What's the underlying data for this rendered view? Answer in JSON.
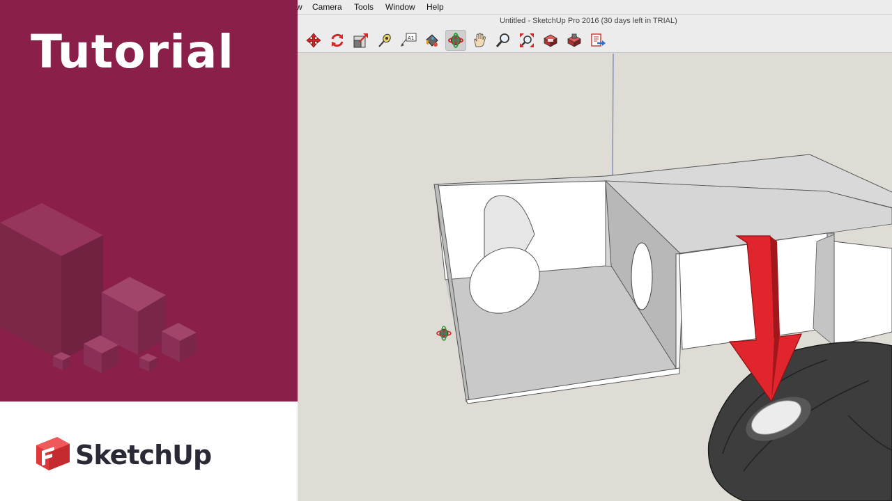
{
  "branding": {
    "heading": "Tutorial",
    "logo_text": "SketchUp",
    "accent_color": "#8a1f4a"
  },
  "menu": {
    "items": [
      {
        "label": "w"
      },
      {
        "label": "Camera"
      },
      {
        "label": "Tools"
      },
      {
        "label": "Window"
      },
      {
        "label": "Help"
      }
    ]
  },
  "window": {
    "title": "Untitled - SketchUp Pro 2016 (30 days left in TRIAL)"
  },
  "toolbar": {
    "tools": [
      {
        "name": "move-icon"
      },
      {
        "name": "rotate-icon"
      },
      {
        "name": "scale-icon"
      },
      {
        "name": "tape-measure-icon"
      },
      {
        "name": "text-label-icon"
      },
      {
        "name": "paint-bucket-icon"
      },
      {
        "name": "orbit-icon"
      },
      {
        "name": "pan-icon"
      },
      {
        "name": "zoom-icon"
      },
      {
        "name": "zoom-extents-icon"
      },
      {
        "name": "warehouse-icon"
      },
      {
        "name": "extension-warehouse-icon"
      },
      {
        "name": "send-to-layout-icon"
      }
    ],
    "active_tool": "orbit-icon"
  },
  "text_label_tool_glyph": "A1"
}
